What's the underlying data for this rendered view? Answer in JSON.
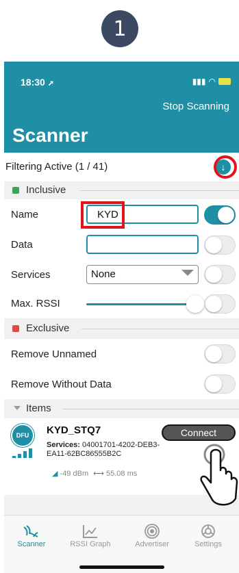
{
  "step_number": "1",
  "status": {
    "time": "18:30"
  },
  "header": {
    "stop_label": "Stop Scanning",
    "title": "Scanner"
  },
  "filter": {
    "label": "Filtering Active (1 / 41)"
  },
  "inclusive": {
    "label": "Inclusive",
    "name_label": "Name",
    "name_value": "KYD",
    "data_label": "Data",
    "data_value": "",
    "services_label": "Services",
    "services_value": "None",
    "rssi_label": "Max. RSSI"
  },
  "exclusive": {
    "label": "Exclusive",
    "remove_unnamed": "Remove Unnamed",
    "remove_without_data": "Remove Without Data"
  },
  "items": {
    "label": "Items",
    "device": {
      "badge": "DFU",
      "name": "KYD_STQ7",
      "services_label": "Services:",
      "services_value": "04001701-4202-DEB3-EA11-62BC86555B2C",
      "rssi": "-49 dBm",
      "interval": "55.08 ms",
      "connect_label": "Connect"
    }
  },
  "tabs": [
    {
      "label": "Scanner",
      "active": true
    },
    {
      "label": "RSSI Graph",
      "active": false
    },
    {
      "label": "Advertiser",
      "active": false
    },
    {
      "label": "Settings",
      "active": false
    }
  ],
  "colors": {
    "accent": "#1e8fa4",
    "highlight": "#e0141b",
    "inclusive": "#3aa655",
    "exclusive": "#e04848"
  },
  "icons": [
    "location-arrow-icon",
    "signal-icon",
    "wifi-icon",
    "battery-icon",
    "download-arrow-icon",
    "chevron-down-icon",
    "hand-pointer-icon",
    "scanner-icon",
    "graph-icon",
    "advertiser-icon",
    "settings-icon"
  ]
}
